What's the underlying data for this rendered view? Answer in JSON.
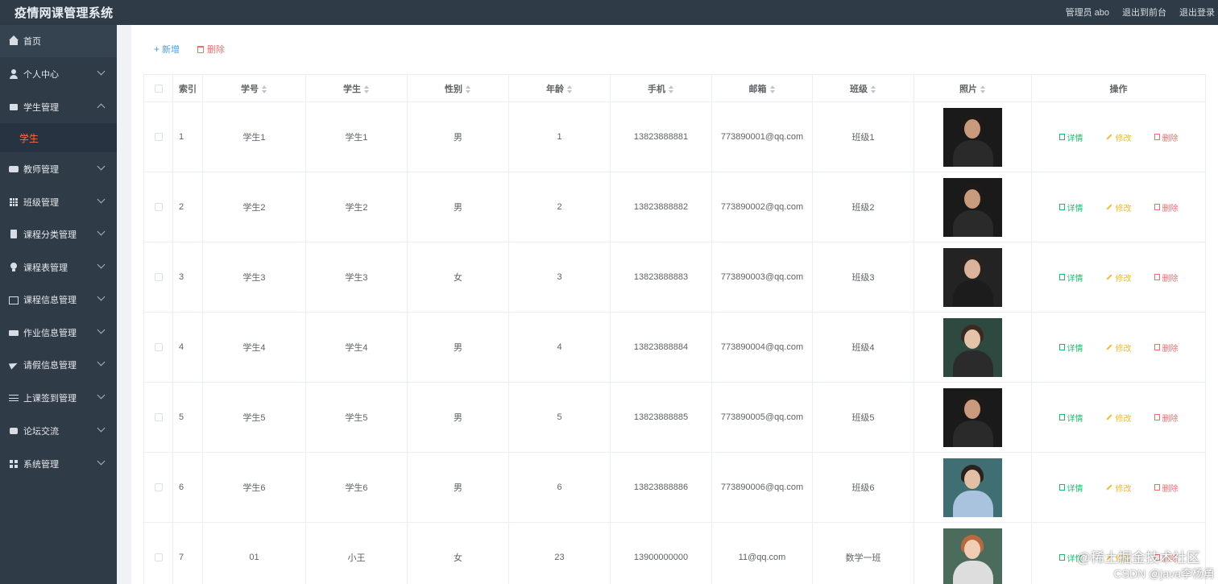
{
  "header": {
    "title": "疫情网课管理系统",
    "admin_label": "管理员 abo",
    "front_link": "退出到前台",
    "logout_link": "退出登录"
  },
  "sidebar": {
    "items": [
      {
        "label": "首页",
        "icon": "home-icon",
        "expandable": false
      },
      {
        "label": "个人中心",
        "icon": "user-icon",
        "expandable": true
      },
      {
        "label": "学生管理",
        "icon": "box-icon",
        "expandable": true,
        "expanded": true
      },
      {
        "label": "教师管理",
        "icon": "chat-icon",
        "expandable": true
      },
      {
        "label": "班级管理",
        "icon": "grid-icon",
        "expandable": true
      },
      {
        "label": "课程分类管理",
        "icon": "document-icon",
        "expandable": true
      },
      {
        "label": "课程表管理",
        "icon": "bulb-icon",
        "expandable": true
      },
      {
        "label": "课程信息管理",
        "icon": "chart-icon",
        "expandable": true
      },
      {
        "label": "作业信息管理",
        "icon": "ticket-icon",
        "expandable": true
      },
      {
        "label": "请假信息管理",
        "icon": "send-icon",
        "expandable": true
      },
      {
        "label": "上课签到管理",
        "icon": "sliders-icon",
        "expandable": true
      },
      {
        "label": "论坛交流",
        "icon": "forum-icon",
        "expandable": true
      },
      {
        "label": "系统管理",
        "icon": "apps-icon",
        "expandable": true
      }
    ],
    "active_subitem": "学生",
    "active_color": "#ff6b4a"
  },
  "toolbar": {
    "add_label": "新增",
    "delete_label": "删除"
  },
  "table": {
    "headers": {
      "index": "索引",
      "student_id": "学号",
      "student": "学生",
      "gender": "性别",
      "age": "年龄",
      "phone": "手机",
      "email": "邮箱",
      "class": "班级",
      "photo": "照片",
      "actions": "操作"
    },
    "action_labels": {
      "detail": "详情",
      "edit": "修改",
      "delete": "删除"
    },
    "rows": [
      {
        "index": "1",
        "student_id": "学生1",
        "student": "学生1",
        "gender": "男",
        "age": "1",
        "phone": "13823888881",
        "email": "773890001@qq.com",
        "class": "班级1",
        "photo": "man-dark-suit"
      },
      {
        "index": "2",
        "student_id": "学生2",
        "student": "学生2",
        "gender": "男",
        "age": "2",
        "phone": "13823888882",
        "email": "773890002@qq.com",
        "class": "班级2",
        "photo": "man-dark-suit"
      },
      {
        "index": "3",
        "student_id": "学生3",
        "student": "学生3",
        "gender": "女",
        "age": "3",
        "phone": "13823888883",
        "email": "773890003@qq.com",
        "class": "班级3",
        "photo": "woman-dark-suit"
      },
      {
        "index": "4",
        "student_id": "学生4",
        "student": "学生4",
        "gender": "男",
        "age": "4",
        "phone": "13823888884",
        "email": "773890004@qq.com",
        "class": "班级4",
        "photo": "woman-green-bg"
      },
      {
        "index": "5",
        "student_id": "学生5",
        "student": "学生5",
        "gender": "男",
        "age": "5",
        "phone": "13823888885",
        "email": "773890005@qq.com",
        "class": "班级5",
        "photo": "man-dark-suit"
      },
      {
        "index": "6",
        "student_id": "学生6",
        "student": "学生6",
        "gender": "男",
        "age": "6",
        "phone": "13823888886",
        "email": "773890006@qq.com",
        "class": "班级6",
        "photo": "woman-teal-bg"
      },
      {
        "index": "7",
        "student_id": "01",
        "student": "小王",
        "gender": "女",
        "age": "23",
        "phone": "13900000000",
        "email": "11@qq.com",
        "class": "数学一班",
        "photo": "woman-red-hair"
      }
    ]
  },
  "watermark": {
    "line1": "@稀土掘金技术社区",
    "line2": "CSDN @java李杨勇"
  }
}
